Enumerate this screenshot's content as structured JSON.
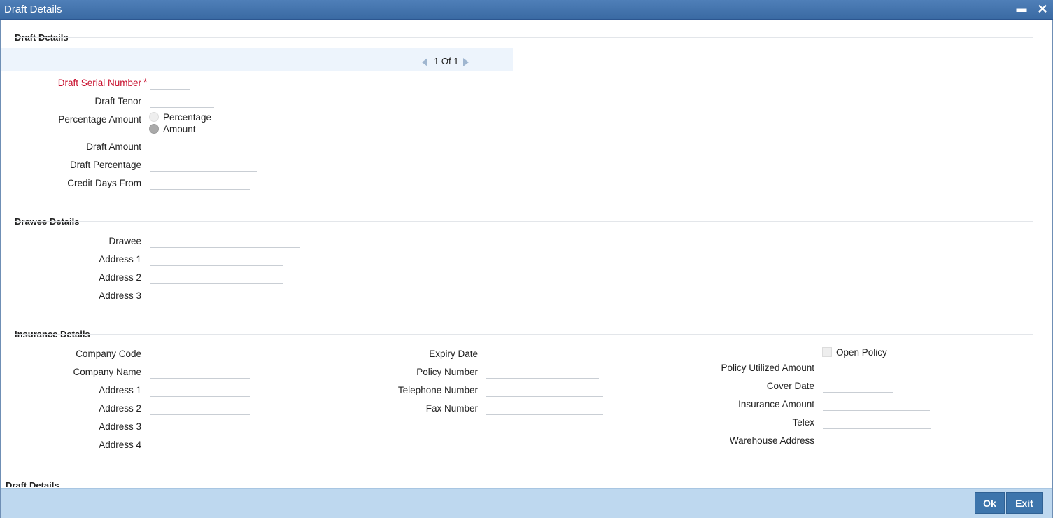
{
  "window": {
    "title": "Draft Details",
    "minimize_label": "▬",
    "close_label": "✕"
  },
  "draft_section": {
    "title": "Draft Details",
    "pager": {
      "current": "1",
      "of_label": "Of",
      "total": "1"
    },
    "fields": {
      "serial_number": {
        "label": "Draft Serial Number",
        "required_mark": "*",
        "value": ""
      },
      "tenor": {
        "label": "Draft Tenor",
        "value": ""
      },
      "percentage_amount": {
        "label": "Percentage Amount",
        "options": [
          "Percentage",
          "Amount"
        ],
        "selected": "Amount"
      },
      "draft_amount": {
        "label": "Draft Amount",
        "value": ""
      },
      "draft_percentage": {
        "label": "Draft Percentage",
        "value": ""
      },
      "credit_days_from": {
        "label": "Credit Days From",
        "value": ""
      }
    }
  },
  "drawee_section": {
    "title": "Drawee Details",
    "fields": {
      "drawee": {
        "label": "Drawee",
        "value": ""
      },
      "address1": {
        "label": "Address 1",
        "value": ""
      },
      "address2": {
        "label": "Address 2",
        "value": ""
      },
      "address3": {
        "label": "Address 3",
        "value": ""
      }
    }
  },
  "insurance_section": {
    "title": "Insurance Details",
    "col1": {
      "company_code": {
        "label": "Company Code",
        "value": ""
      },
      "company_name": {
        "label": "Company Name",
        "value": ""
      },
      "address1": {
        "label": "Address 1",
        "value": ""
      },
      "address2": {
        "label": "Address 2",
        "value": ""
      },
      "address3": {
        "label": "Address 3",
        "value": ""
      },
      "address4": {
        "label": "Address 4",
        "value": ""
      }
    },
    "col2": {
      "expiry_date": {
        "label": "Expiry Date",
        "value": ""
      },
      "policy_number": {
        "label": "Policy Number",
        "value": ""
      },
      "telephone_number": {
        "label": "Telephone Number",
        "value": ""
      },
      "fax_number": {
        "label": "Fax Number",
        "value": ""
      }
    },
    "col3": {
      "open_policy": {
        "label": "Open Policy",
        "checked": false
      },
      "policy_utilized_amount": {
        "label": "Policy Utilized Amount",
        "value": ""
      },
      "cover_date": {
        "label": "Cover Date",
        "value": ""
      },
      "insurance_amount": {
        "label": "Insurance Amount",
        "value": ""
      },
      "telex": {
        "label": "Telex",
        "value": ""
      },
      "warehouse_address": {
        "label": "Warehouse Address",
        "value": ""
      }
    }
  },
  "next_section": {
    "title": "Draft Details"
  },
  "footer": {
    "ok_label": "Ok",
    "exit_label": "Exit"
  },
  "colors": {
    "title_bar": "#3a6aa3",
    "footer": "#bed8ef",
    "button": "#3d75ac",
    "required": "#c8102e",
    "pager_band": "#edf4fc"
  }
}
